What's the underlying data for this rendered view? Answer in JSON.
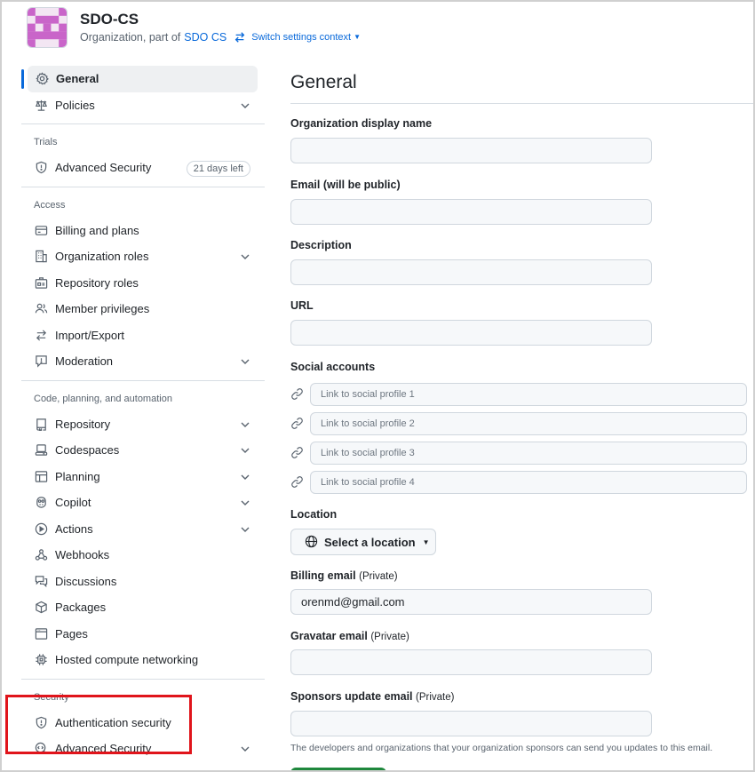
{
  "header": {
    "org_name": "SDO-CS",
    "subtitle_prefix": "Organization, part of",
    "parent_org": "SDO CS",
    "switch_context": "Switch settings context"
  },
  "sidebar": {
    "general": "General",
    "policies": "Policies",
    "trials_heading": "Trials",
    "advanced_security_trial": "Advanced Security",
    "trial_badge": "21 days left",
    "access_heading": "Access",
    "access_items": [
      {
        "label": "Billing and plans",
        "icon": "credit-card-icon"
      },
      {
        "label": "Organization roles",
        "icon": "organization-icon"
      },
      {
        "label": "Repository roles",
        "icon": "id-badge-icon"
      },
      {
        "label": "Member privileges",
        "icon": "people-icon"
      },
      {
        "label": "Import/Export",
        "icon": "arrow-switch-icon"
      },
      {
        "label": "Moderation",
        "icon": "report-icon"
      }
    ],
    "code_heading": "Code, planning, and automation",
    "code_items": [
      {
        "label": "Repository",
        "icon": "repo-icon"
      },
      {
        "label": "Codespaces",
        "icon": "codespaces-icon"
      },
      {
        "label": "Planning",
        "icon": "table-icon"
      },
      {
        "label": "Copilot",
        "icon": "copilot-icon"
      },
      {
        "label": "Actions",
        "icon": "play-icon"
      },
      {
        "label": "Webhooks",
        "icon": "webhook-icon"
      },
      {
        "label": "Discussions",
        "icon": "comment-discussion-icon"
      },
      {
        "label": "Packages",
        "icon": "package-icon"
      },
      {
        "label": "Pages",
        "icon": "browser-icon"
      },
      {
        "label": "Hosted compute networking",
        "icon": "cpu-icon"
      }
    ],
    "security_heading": "Security",
    "auth_security": "Authentication security",
    "advanced_security": "Advanced Security"
  },
  "main": {
    "title": "General",
    "display_name_label": "Organization display name",
    "display_name_value": "",
    "email_label": "Email (will be public)",
    "email_value": "",
    "description_label": "Description",
    "description_value": "",
    "url_label": "URL",
    "url_value": "",
    "social_label": "Social accounts",
    "social_placeholders": [
      "Link to social profile 1",
      "Link to social profile 2",
      "Link to social profile 3",
      "Link to social profile 4"
    ],
    "location_label": "Location",
    "location_button": "Select a location",
    "billing_label": "Billing email",
    "billing_muted": "(Private)",
    "billing_value": "orenmd@gmail.com",
    "gravatar_label": "Gravatar email",
    "gravatar_muted": "(Private)",
    "gravatar_value": "",
    "sponsors_label": "Sponsors update email",
    "sponsors_muted": "(Private)",
    "sponsors_value": "",
    "sponsors_help": "The developers and organizations that your organization sponsors can send you updates to this email."
  },
  "colors": {
    "accent": "#0969da",
    "highlight": "#e0141b",
    "avatar": "#c965c9",
    "primary_button": "#1f883d"
  }
}
